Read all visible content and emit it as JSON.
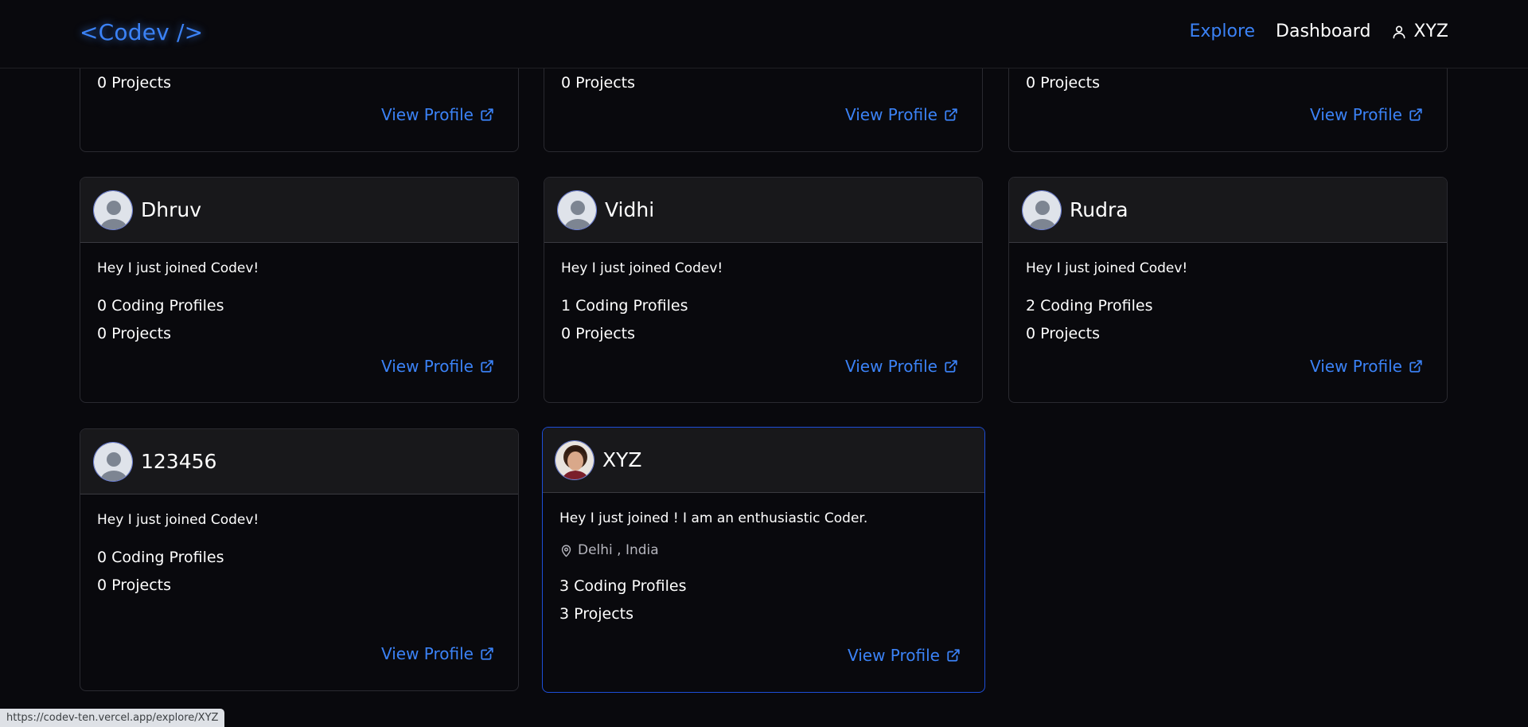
{
  "header": {
    "logo": "<Codev />",
    "nav": {
      "explore": "Explore",
      "dashboard": "Dashboard",
      "user": "XYZ"
    }
  },
  "top_row_cards": [
    {
      "projects": "0 Projects",
      "view_label": "View Profile"
    },
    {
      "projects": "0 Projects",
      "view_label": "View Profile"
    },
    {
      "projects": "0 Projects",
      "view_label": "View Profile"
    }
  ],
  "cards": [
    {
      "name": "Dhruv",
      "bio": "Hey I just joined Codev!",
      "coding_profiles": "0 Coding Profiles",
      "projects": "0 Projects",
      "view_label": "View Profile"
    },
    {
      "name": "Vidhi",
      "bio": "Hey I just joined Codev!",
      "coding_profiles": "1 Coding Profiles",
      "projects": "0 Projects",
      "view_label": "View Profile"
    },
    {
      "name": "Rudra",
      "bio": "Hey I just joined Codev!",
      "coding_profiles": "2 Coding Profiles",
      "projects": "0 Projects",
      "view_label": "View Profile"
    },
    {
      "name": "123456",
      "bio": "Hey I just joined Codev!",
      "coding_profiles": "0 Coding Profiles",
      "projects": "0 Projects",
      "view_label": "View Profile"
    },
    {
      "name": "XYZ",
      "bio": "Hey I just joined ! I am an enthusiastic Coder.",
      "location": "Delhi , India",
      "coding_profiles": "3 Coding Profiles",
      "projects": "3 Projects",
      "view_label": "View Profile"
    }
  ],
  "status_bar": {
    "url": "https://codev-ten.vercel.app/explore/XYZ"
  },
  "colors": {
    "accent": "#3b82f6",
    "background": "#09090d",
    "card_header": "#18181b"
  }
}
